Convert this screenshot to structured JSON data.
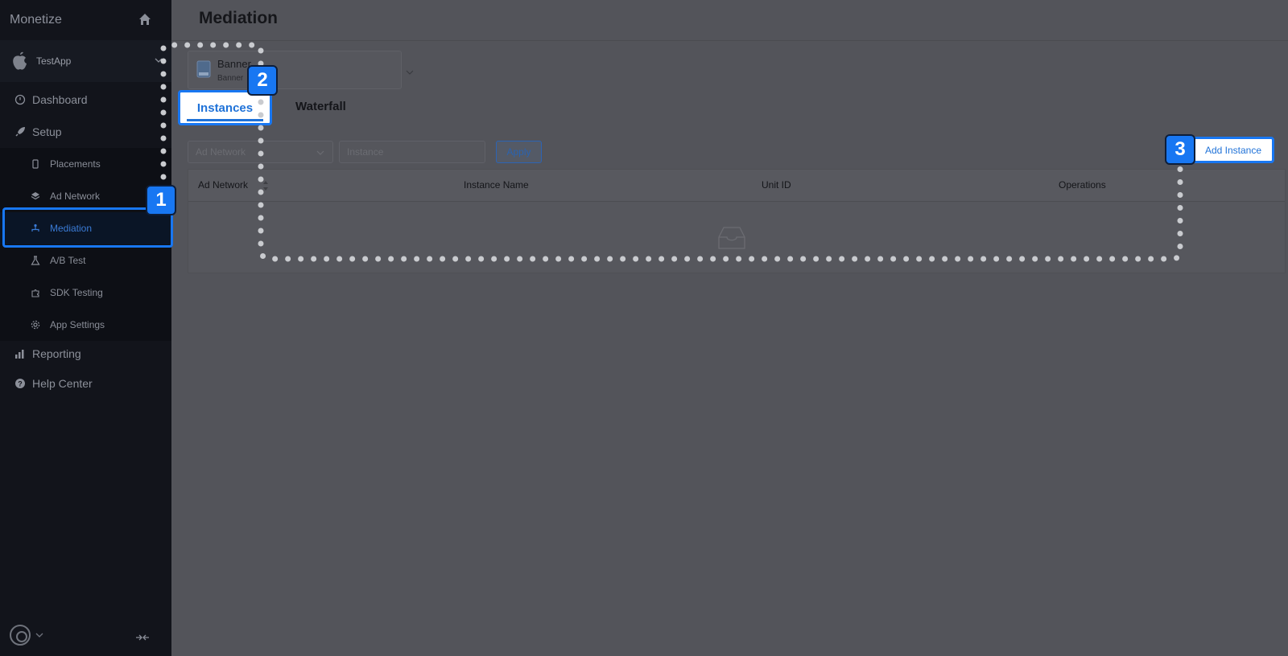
{
  "sidebar": {
    "brand": "Monetize",
    "app_name": "TestApp",
    "nav": {
      "dashboard": "Dashboard",
      "setup": "Setup",
      "reporting": "Reporting",
      "help_center": "Help Center"
    },
    "setup_items": {
      "placements": "Placements",
      "ad_network": "Ad Network",
      "mediation": "Mediation",
      "ab_test": "A/B Test",
      "sdk_testing": "SDK Testing",
      "app_settings": "App Settings"
    },
    "active_item": "Mediation"
  },
  "main": {
    "title": "Mediation",
    "placement": {
      "title": "Banner",
      "subtitle": "Banner"
    },
    "tabs": {
      "instances": "Instances",
      "waterfall": "Waterfall"
    },
    "active_tab": "Instances",
    "filters": {
      "ad_network_placeholder": "Ad Network",
      "instance_placeholder": "Instance",
      "apply_label": "Apply"
    },
    "add_instance_label": "Add Instance",
    "table": {
      "columns": {
        "ad_network": "Ad Network",
        "instance_name": "Instance Name",
        "unit_id": "Unit ID",
        "operations": "Operations"
      },
      "rows": []
    }
  },
  "annotations": {
    "step1": "1",
    "step2": "2",
    "step3": "3"
  },
  "colors": {
    "accent": "#1877f2",
    "sidebar_bg": "#12141b",
    "main_bg": "#53545a"
  }
}
